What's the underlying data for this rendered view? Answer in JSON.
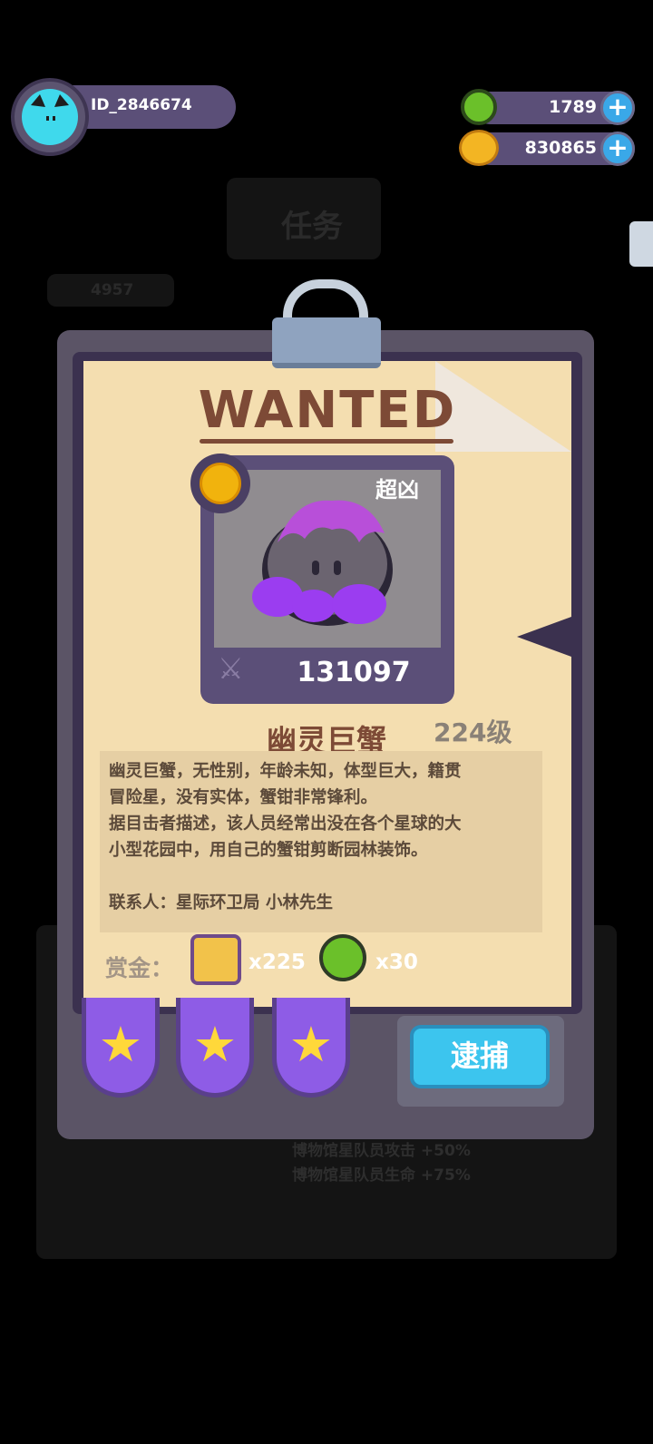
{
  "player": {
    "id": "ID_2846674"
  },
  "currency": [
    {
      "icon": "green-donut-icon",
      "value": "1789"
    },
    {
      "icon": "gold-planet-icon",
      "value": "830865"
    }
  ],
  "background": {
    "title": "任务",
    "counter": "4957",
    "bonus_lines": [
      "博物馆星队员攻击 +50%",
      "博物馆星队员生命 +75%"
    ]
  },
  "wanted": {
    "heading": "WANTED",
    "rarity": "超凶",
    "power": "131097",
    "name": "幽灵巨蟹",
    "level": "224级",
    "description": "幽灵巨蟹，无性别，年龄未知，体型巨大，籍贯\n冒险星，没有实体，蟹钳非常锋利。\n据目击者描述，该人员经常出没在各个星球的大\n小型花园中，用自己的蟹钳剪断园林装饰。\n\n联系人：星际环卫局 小林先生",
    "reward_label": "赏金：",
    "rewards": [
      {
        "icon": "yellow-block-icon",
        "qty": "x225"
      },
      {
        "icon": "green-donut-icon",
        "qty": "x30"
      }
    ],
    "stars": 3,
    "arrest_label": "逮捕"
  },
  "colors": {
    "accent": "#3cc5ee",
    "panel": "#5b4f78",
    "paper": "#f4deb0",
    "title": "#7d4a36"
  }
}
